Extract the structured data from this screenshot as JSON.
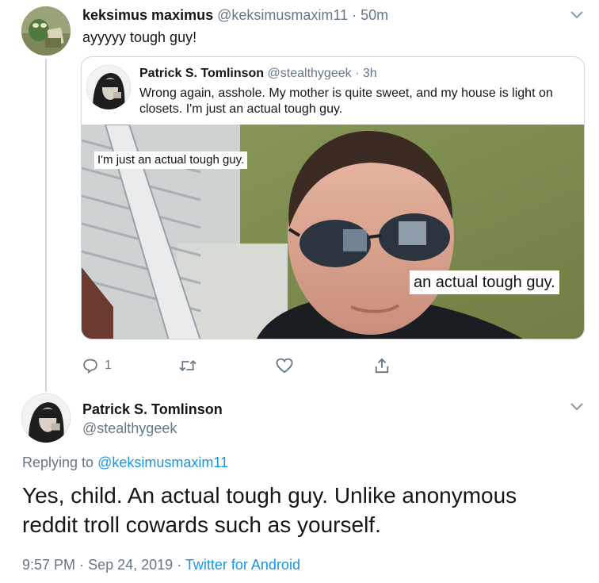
{
  "top_tweet": {
    "author_name": "keksimus maximus",
    "author_handle": "@keksimusmaxim11",
    "separator": "·",
    "time": "50m",
    "text": "ayyyyy tough guy!",
    "quoted_tweet": {
      "author_name": "Patrick S. Tomlinson",
      "author_handle": "@stealthygeek",
      "separator": "·",
      "time": "3h",
      "text": "Wrong again, asshole. My mother is quite sweet, and my house is light on closets. I'm just an actual tough guy.",
      "media_captions": [
        "I'm just an actual tough guy.",
        "an actual tough guy."
      ]
    },
    "actions": {
      "reply_icon": "reply-icon",
      "reply_count": "1",
      "retweet_icon": "retweet-icon",
      "like_icon": "heart-icon",
      "share_icon": "share-icon"
    }
  },
  "main_tweet": {
    "author_name": "Patrick S. Tomlinson",
    "author_handle": "@stealthygeek",
    "replying_prefix": "Replying to",
    "replying_to": "@keksimusmaxim11",
    "text": "Yes, child. An actual tough guy. Unlike anonymous reddit troll cowards such as yourself.",
    "time": "9:57 PM",
    "separator": "·",
    "date": "Sep 24, 2019",
    "source": "Twitter for Android"
  },
  "colors": {
    "link": "#1b95e0",
    "secondary_text": "#657786",
    "border": "#ccd6dd",
    "thread_line": "#cfd9de"
  }
}
